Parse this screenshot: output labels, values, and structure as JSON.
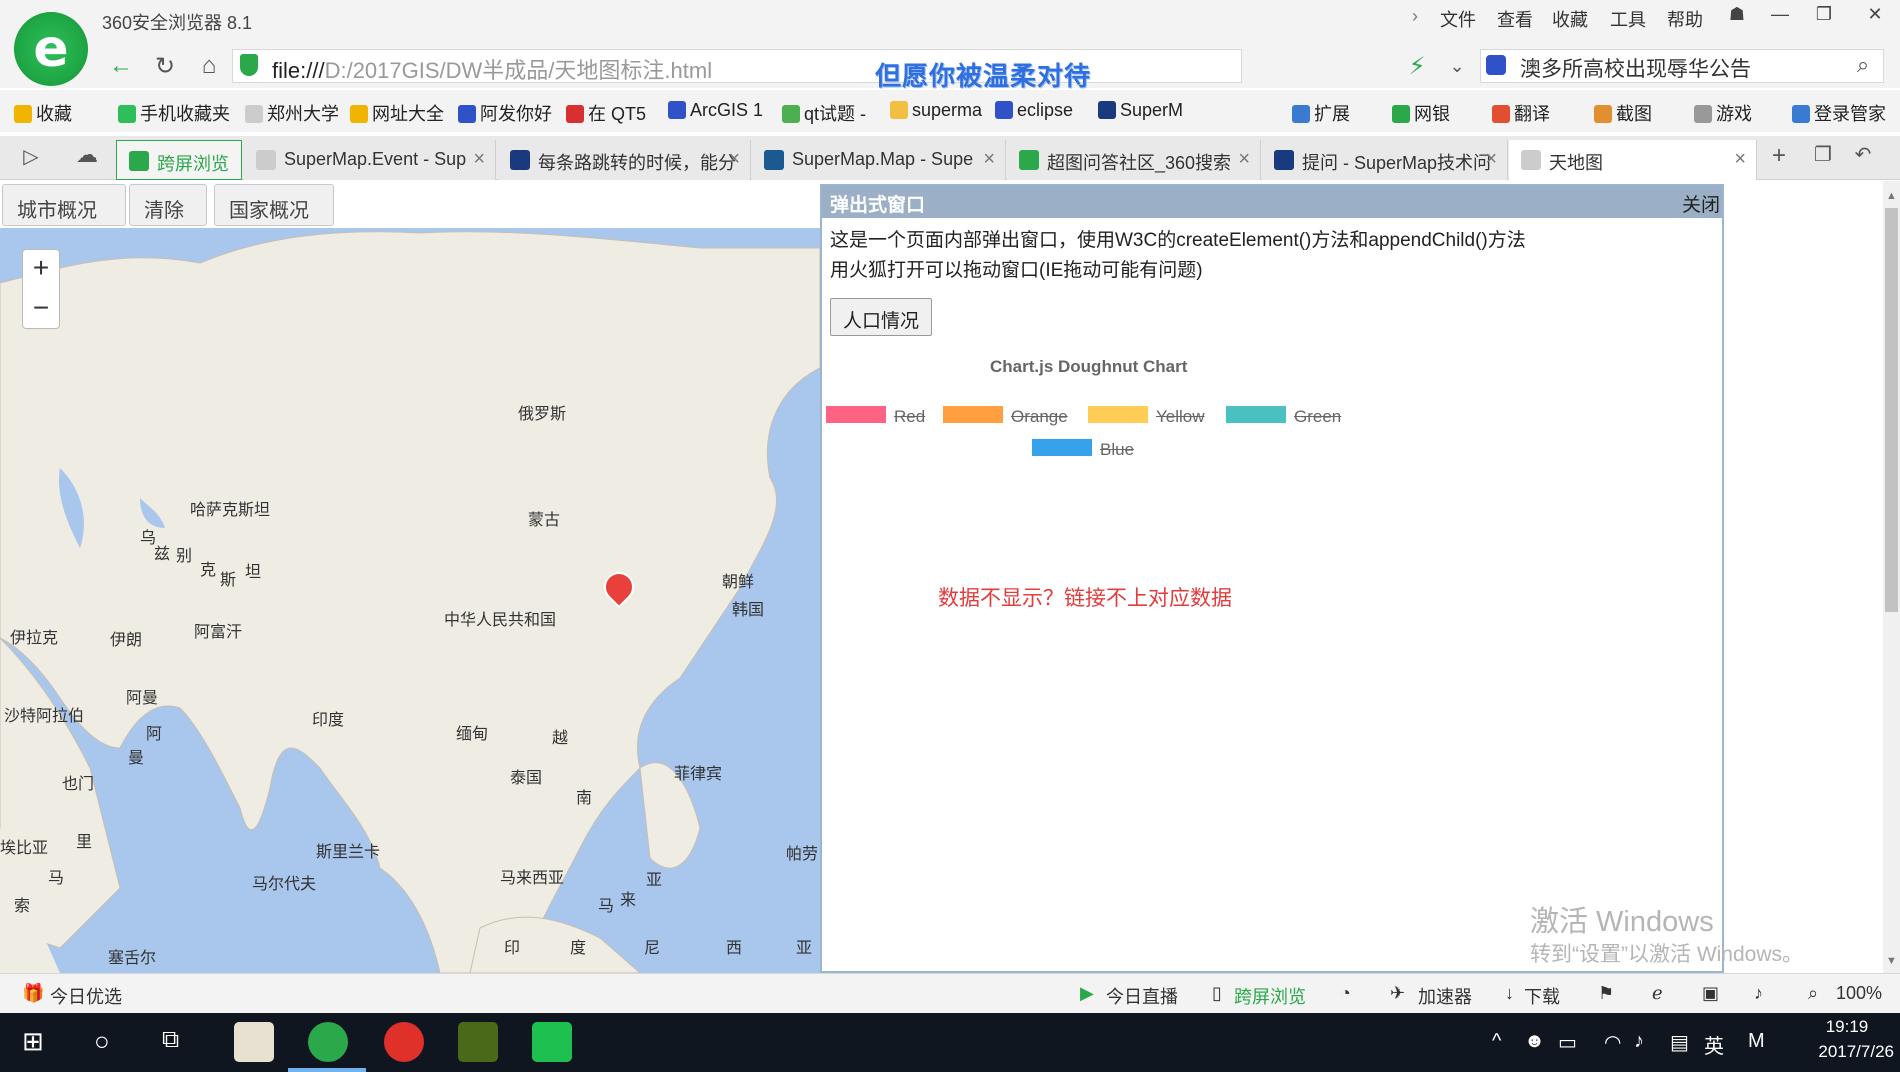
{
  "window": {
    "app_title": "360安全浏览器 8.1",
    "menu": [
      "文件",
      "查看",
      "收藏",
      "工具",
      "帮助"
    ]
  },
  "address": {
    "url_prefix": "file:///",
    "url_rest": "D:/2017GIS/DW半成品/天地图标注.html",
    "slogan": "但愿你被温柔对待",
    "search_text": "澳多所高校出现辱华公告"
  },
  "bookmarks": [
    {
      "label": "收藏",
      "color": "#f1b400"
    },
    {
      "label": "手机收藏夹",
      "color": "#2fbf5a"
    },
    {
      "label": "郑州大学",
      "color": "#cccccc"
    },
    {
      "label": "网址大全",
      "color": "#f1b400"
    },
    {
      "label": "阿发你好",
      "color": "#3052c8"
    },
    {
      "label": "在 QT5",
      "color": "#d83030"
    },
    {
      "label": "ArcGIS 1",
      "color": "#3052c8"
    },
    {
      "label": "qt试题 -",
      "color": "#4caf50"
    },
    {
      "label": "superma",
      "color": "#f1c040"
    },
    {
      "label": "eclipse",
      "color": "#3052c8"
    },
    {
      "label": "SuperM",
      "color": "#1a3a80"
    }
  ],
  "bookmarks_right": [
    "扩展",
    "网银",
    "翻译",
    "截图",
    "游戏",
    "登录管家"
  ],
  "tabs": [
    {
      "label": "跨屏浏览",
      "active": false,
      "special": true
    },
    {
      "label": "SuperMap.Event - Sup",
      "active": false
    },
    {
      "label": "每条路跳转的时候，能分",
      "active": false
    },
    {
      "label": "SuperMap.Map - Supe",
      "active": false
    },
    {
      "label": "超图问答社区_360搜索",
      "active": false
    },
    {
      "label": "提问 - SuperMap技术问",
      "active": false
    },
    {
      "label": "天地图",
      "active": true
    }
  ],
  "page_buttons": [
    "城市概况",
    "清除",
    "国家概况"
  ],
  "map": {
    "zoom_in": "+",
    "zoom_out": "−",
    "labels": [
      {
        "text": "俄罗斯"
      },
      {
        "text": "哈萨克斯坦"
      },
      {
        "text": "蒙古"
      },
      {
        "text": "乌"
      },
      {
        "text": "兹"
      },
      {
        "text": "别"
      },
      {
        "text": "克"
      },
      {
        "text": "斯"
      },
      {
        "text": "坦"
      },
      {
        "text": "朝鲜"
      },
      {
        "text": "韩国"
      },
      {
        "text": "中华人民共和国"
      },
      {
        "text": "伊拉克"
      },
      {
        "text": "伊朗"
      },
      {
        "text": "阿富汗"
      },
      {
        "text": "阿曼"
      },
      {
        "text": "沙特阿拉伯"
      },
      {
        "text": "阿"
      },
      {
        "text": "曼"
      },
      {
        "text": "印度"
      },
      {
        "text": "缅甸"
      },
      {
        "text": "越"
      },
      {
        "text": "泰国"
      },
      {
        "text": "南"
      },
      {
        "text": "菲律宾"
      },
      {
        "text": "也门"
      },
      {
        "text": "斯里兰卡"
      },
      {
        "text": "马尔代夫"
      },
      {
        "text": "马来西亚"
      },
      {
        "text": "亚"
      },
      {
        "text": "来"
      },
      {
        "text": "马"
      },
      {
        "text": "帕劳"
      },
      {
        "text": "塞舌尔"
      },
      {
        "text": "印"
      },
      {
        "text": "度"
      },
      {
        "text": "尼"
      },
      {
        "text": "西"
      },
      {
        "text": "亚"
      },
      {
        "text": "索"
      },
      {
        "text": "马"
      },
      {
        "text": "埃比亚"
      },
      {
        "text": "里"
      }
    ]
  },
  "popup": {
    "title": "弹出式窗口",
    "close": "关闭",
    "desc_line1": "这是一个页面内部弹出窗口，使用W3C的createElement()方法和appendChild()方法",
    "desc_line2": "用火狐打开可以拖动窗口(IE拖动可能有问题)",
    "button": "人口情况",
    "no_data_msg": "数据不显示？链接不上对应数据"
  },
  "chart_data": {
    "type": "pie",
    "title": "Chart.js Doughnut Chart",
    "legend": [
      {
        "label": "Red",
        "color": "#ff6384",
        "hidden": true
      },
      {
        "label": "Orange",
        "color": "#ff9f40",
        "hidden": true
      },
      {
        "label": "Yellow",
        "color": "#ffcd56",
        "hidden": true
      },
      {
        "label": "Green",
        "color": "#4bc0c0",
        "hidden": true
      },
      {
        "label": "Blue",
        "color": "#36a2eb",
        "hidden": true
      }
    ],
    "values": []
  },
  "watermark": {
    "line1": "激活 Windows",
    "line2": "转到“设置”以激活 Windows。"
  },
  "statusbar": {
    "left": "今日优选",
    "live": "今日直播",
    "cross": "跨屏浏览",
    "accel": "加速器",
    "download": "下载",
    "zoom": "100%"
  },
  "taskbar": {
    "ime": "英",
    "time": "19:19",
    "date": "2017/7/26"
  }
}
